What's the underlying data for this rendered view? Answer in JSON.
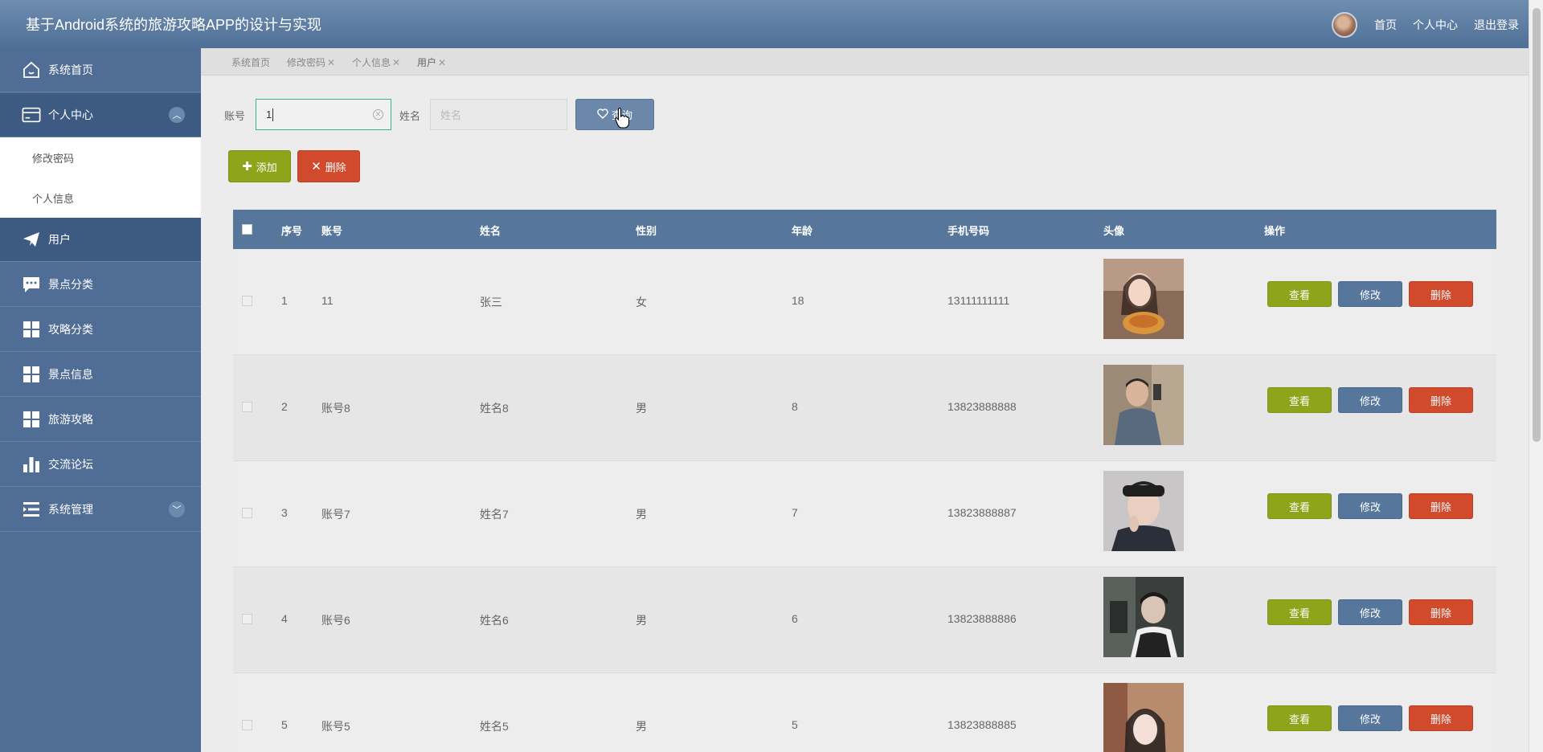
{
  "header": {
    "title": "基于Android系统的旅游攻略APP的设计与实现",
    "nav": [
      "首页",
      "个人中心",
      "退出登录"
    ]
  },
  "sidebar": {
    "items": [
      {
        "label": "系统首页",
        "icon": "home-icon"
      },
      {
        "label": "个人中心",
        "icon": "wallet-icon",
        "expanded": true
      },
      {
        "label": "修改密码",
        "sub": true
      },
      {
        "label": "个人信息",
        "sub": true
      },
      {
        "label": "用户",
        "icon": "send-icon",
        "active": true
      },
      {
        "label": "景点分类",
        "icon": "chat-icon"
      },
      {
        "label": "攻略分类",
        "icon": "grid-icon"
      },
      {
        "label": "景点信息",
        "icon": "grid-icon"
      },
      {
        "label": "旅游攻略",
        "icon": "grid-icon"
      },
      {
        "label": "交流论坛",
        "icon": "bar-chart-icon"
      },
      {
        "label": "系统管理",
        "icon": "list-icon",
        "expanded": false
      }
    ]
  },
  "tabs": [
    {
      "label": "系统首页",
      "closable": false
    },
    {
      "label": "修改密码",
      "closable": true
    },
    {
      "label": "个人信息",
      "closable": true
    },
    {
      "label": "用户",
      "closable": true
    }
  ],
  "search": {
    "account_label": "账号",
    "account_value": "1",
    "name_label": "姓名",
    "name_placeholder": "姓名",
    "search_button": "查询"
  },
  "actions": {
    "add": "添加",
    "delete": "删除"
  },
  "table": {
    "columns": [
      "序号",
      "账号",
      "姓名",
      "性别",
      "年龄",
      "手机号码",
      "头像",
      "操作"
    ],
    "row_buttons": {
      "view": "查看",
      "edit": "修改",
      "delete": "删除"
    },
    "rows": [
      {
        "index": "1",
        "account": "11",
        "name": "张三",
        "gender": "女",
        "age": "18",
        "phone": "13111111111"
      },
      {
        "index": "2",
        "account": "账号8",
        "name": "姓名8",
        "gender": "男",
        "age": "8",
        "phone": "13823888888"
      },
      {
        "index": "3",
        "account": "账号7",
        "name": "姓名7",
        "gender": "男",
        "age": "7",
        "phone": "13823888887"
      },
      {
        "index": "4",
        "account": "账号6",
        "name": "姓名6",
        "gender": "男",
        "age": "6",
        "phone": "13823888886"
      },
      {
        "index": "5",
        "account": "账号5",
        "name": "姓名5",
        "gender": "男",
        "age": "5",
        "phone": "13823888885"
      }
    ]
  },
  "colors": {
    "header": "#5a7aa0",
    "sidebar": "#4f6d95",
    "primary_green": "#8ea51b",
    "danger_red": "#d24a2c",
    "edit_blue": "#56769c"
  }
}
